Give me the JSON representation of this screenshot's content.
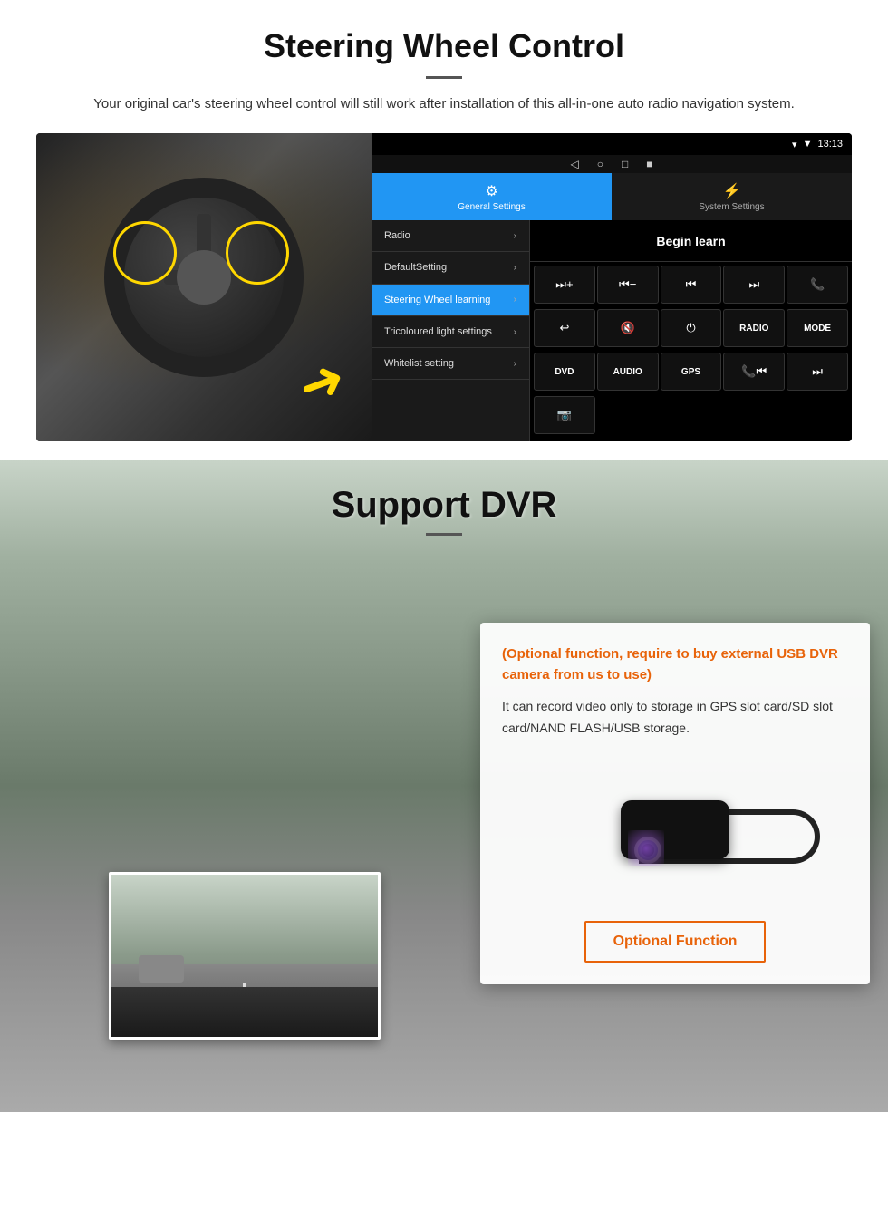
{
  "steering_section": {
    "title": "Steering Wheel Control",
    "subtitle": "Your original car's steering wheel control will still work after installation of this all-in-one auto radio navigation system.",
    "android_ui": {
      "statusbar": {
        "time": "13:13",
        "signal_icon": "▼",
        "wifi_icon": "▾"
      },
      "nav_buttons": [
        "◁",
        "○",
        "□",
        "■"
      ],
      "tabs": [
        {
          "label": "General Settings",
          "icon": "⚙",
          "active": true
        },
        {
          "label": "System Settings",
          "icon": "⚡",
          "active": false
        }
      ],
      "menu_items": [
        {
          "label": "Radio",
          "active": false
        },
        {
          "label": "DefaultSetting",
          "active": false
        },
        {
          "label": "Steering Wheel learning",
          "active": true
        },
        {
          "label": "Tricoloured light settings",
          "active": false
        },
        {
          "label": "Whitelist setting",
          "active": false
        }
      ],
      "begin_learn": "Begin learn",
      "control_buttons": [
        "⏭+",
        "⏮−",
        "⏮⏮",
        "⏭⏭",
        "📞",
        "↩",
        "🔇×",
        "⏻",
        "RADIO",
        "MODE",
        "DVD",
        "AUDIO",
        "GPS",
        "📞⏮",
        "⏭⏭"
      ]
    }
  },
  "dvr_section": {
    "title": "Support DVR",
    "optional_text": "(Optional function, require to buy external USB DVR camera from us to use)",
    "description": "It can record video only to storage in GPS slot card/SD slot card/NAND FLASH/USB storage.",
    "optional_btn_label": "Optional Function"
  }
}
